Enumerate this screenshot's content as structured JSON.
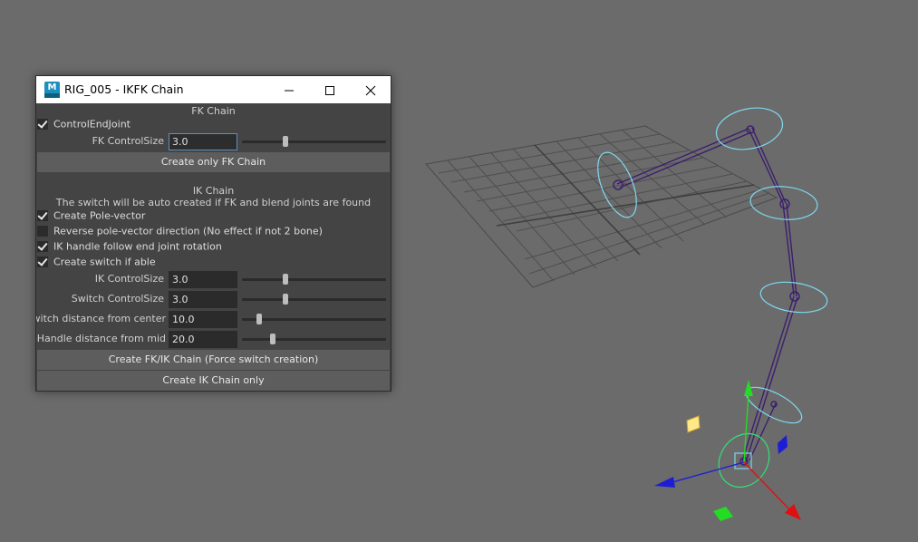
{
  "window": {
    "title": "RIG_005 - IKFK Chain",
    "app_icon_letter": "M"
  },
  "fk": {
    "section_title": "FK Chain",
    "control_end_joint": {
      "label": "ControlEndJoint",
      "checked": true
    },
    "control_size": {
      "label": "FK ControlSize",
      "value": "3.0",
      "slider_fraction": 0.3
    },
    "create_button": "Create only FK Chain"
  },
  "ik": {
    "section_title": "IK Chain",
    "note": "The switch will be auto created if FK and blend joints are found",
    "checks": [
      {
        "label": "Create Pole-vector",
        "checked": true
      },
      {
        "label": "Reverse pole-vector direction (No effect if not 2 bone)",
        "checked": false
      },
      {
        "label": "IK handle follow end joint rotation",
        "checked": true
      },
      {
        "label": "Create switch if able",
        "checked": true
      }
    ],
    "fields": [
      {
        "label": "IK ControlSize",
        "value": "3.0",
        "slider_fraction": 0.3
      },
      {
        "label": "Switch ControlSize",
        "value": "3.0",
        "slider_fraction": 0.3
      },
      {
        "label": "Switch distance from center",
        "value": "10.0",
        "slider_fraction": 0.12
      },
      {
        "label": "PoleHandle distance from mid",
        "value": "20.0",
        "slider_fraction": 0.22
      }
    ],
    "create_fkik_button": "Create FK/IK Chain (Force switch creation)",
    "create_ik_button": "Create IK Chain only"
  },
  "colors": {
    "viewport_bg": "#6b6b6b",
    "window_bg": "#444444",
    "field_bg": "#2b2b2b",
    "button_bg": "#5d5d5d",
    "rig_control": "#7fd8ef",
    "joint_chain": "#3c1f6e",
    "axis_x": "#e01010",
    "axis_y": "#22dd22",
    "axis_z": "#1d1dd8"
  }
}
